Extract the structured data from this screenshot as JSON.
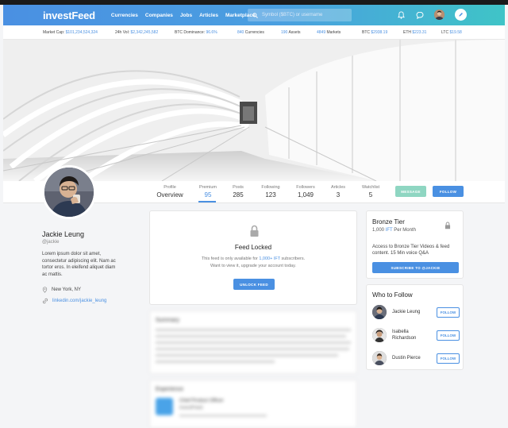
{
  "nav": {
    "logo": "investFeed",
    "menu": [
      "Currencies",
      "Companies",
      "Jobs",
      "Articles",
      "Marketplace"
    ],
    "search_placeholder": "Symbol ($BTC) or username"
  },
  "ticker": [
    {
      "label": "Market Cap:",
      "value": "$101,234,524,324"
    },
    {
      "label": "24h Vol:",
      "value": "$2,342,245,582"
    },
    {
      "label": "BTC Dominance:",
      "value": "96.6%"
    },
    {
      "label": "",
      "value": "840",
      "suffix": "Currencies"
    },
    {
      "label": "",
      "value": "190",
      "suffix": "Assets"
    },
    {
      "label": "",
      "value": "4849",
      "suffix": "Markets"
    },
    {
      "label": "BTC",
      "value": "$2938.19"
    },
    {
      "label": "ETH",
      "value": "$223.31"
    },
    {
      "label": "LTC",
      "value": "$19.58"
    }
  ],
  "stats": [
    {
      "label": "Profile",
      "value": "Overview"
    },
    {
      "label": "Premium",
      "value": "95"
    },
    {
      "label": "Posts",
      "value": "285"
    },
    {
      "label": "Following",
      "value": "123"
    },
    {
      "label": "Followers",
      "value": "1,049"
    },
    {
      "label": "Articles",
      "value": "3"
    },
    {
      "label": "Watchlist",
      "value": "5"
    }
  ],
  "buttons": {
    "message": "MESSAGE",
    "follow": "FOLLOW"
  },
  "profile": {
    "name": "Jackie Leung",
    "handle": "@jackie",
    "bio": "Lorem ipsum dolor sit amet, consectetur adipiscing elit. Nam ac tortor eros. In eleifend aliquet diam ac mattis.",
    "location": "New York, NY",
    "linkedin": "linkedin.com/jackie_leung"
  },
  "locked": {
    "title": "Feed Locked",
    "line1_pre": "This feed is only available for ",
    "line1_value": "1,000+ IFT",
    "line1_post": " subscribers.",
    "line2": "Want to view it, upgrade your account today.",
    "button": "UNLOCK FEED"
  },
  "blurred": {
    "summary_title": "Summary",
    "experience_title": "Experience",
    "job_title": "Chief Product Officer",
    "company": "investFeed"
  },
  "tier": {
    "title": "Bronze Tier",
    "price_pre": "1,000 ",
    "price_value": "IFT",
    "price_post": " Per Month",
    "desc": "Access to Bronze Tier Videos & feed content. 15 Min voice Q&A",
    "button": "SUBSCRIBE TO @JACKIE"
  },
  "who": {
    "title": "Who to Follow",
    "people": [
      {
        "name": "Jackie Leung",
        "button": "FOLLOW"
      },
      {
        "name": "Isabella Richardson",
        "button": "FOLLOW"
      },
      {
        "name": "Dustin Pierce",
        "button": "FOLLOW"
      }
    ]
  },
  "colors": {
    "accent": "#4a90e2",
    "teal": "#3fc4c7",
    "message": "#8fd6c2"
  }
}
